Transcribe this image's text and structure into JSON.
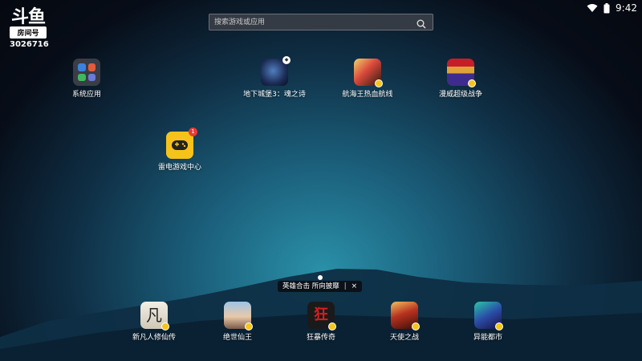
{
  "watermark": {
    "logo": "斗鱼",
    "room_label": "房间号",
    "room_number": "3026716"
  },
  "status_bar": {
    "time": "9:42",
    "icons": [
      "wifi-icon",
      "battery-icon"
    ]
  },
  "search": {
    "placeholder": "搜索游戏或应用"
  },
  "desktop_apps": [
    {
      "label": "系统应用",
      "icon": "system-apps-folder-icon"
    },
    {
      "label": "地下城堡3：魂之诗",
      "icon": "dungeon-castle-game-icon"
    },
    {
      "label": "航海王热血航线",
      "icon": "one-piece-game-icon"
    },
    {
      "label": "漫威超级战争",
      "icon": "marvel-super-war-game-icon"
    },
    {
      "label": "雷电游戏中心",
      "icon": "gamepad-icon",
      "badge": "1"
    }
  ],
  "dock_apps": [
    {
      "label": "新凡人修仙传",
      "icon": "fanren-game-icon",
      "glyph": "凡"
    },
    {
      "label": "绝世仙王",
      "icon": "jueshi-game-icon"
    },
    {
      "label": "狂暴传奇",
      "icon": "kuangbao-game-icon",
      "glyph": "狂"
    },
    {
      "label": "天使之战",
      "icon": "angel-war-game-icon"
    },
    {
      "label": "异能都市",
      "icon": "yineng-game-icon"
    }
  ],
  "toast": {
    "text": "英雄合击 所向披靡",
    "close": "×"
  },
  "colors": {
    "accent_yellow": "#f7c31a",
    "badge_red": "#e83a3a"
  }
}
